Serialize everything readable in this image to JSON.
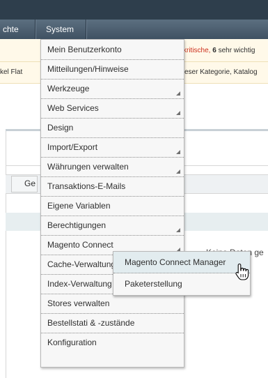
{
  "nav": {
    "partial_label": "chte",
    "system_label": "System"
  },
  "notices": {
    "line1_prefix": "kritische,",
    "line1_count": "6",
    "line1_suffix": "sehr wichtig",
    "line2_left": "kel Flat",
    "line2_right": "eser Kategorie, Katalog"
  },
  "content": {
    "tab_label": "Ge",
    "no_data_text": "Keine Daten ge"
  },
  "system_menu": {
    "items": [
      {
        "label": "Mein Benutzerkonto",
        "has_submenu": false
      },
      {
        "label": "Mitteilungen/Hinweise",
        "has_submenu": false
      },
      {
        "label": "Werkzeuge",
        "has_submenu": true
      },
      {
        "label": "Web Services",
        "has_submenu": true
      },
      {
        "label": "Design",
        "has_submenu": false
      },
      {
        "label": "Import/Export",
        "has_submenu": true
      },
      {
        "label": "Währungen verwalten",
        "has_submenu": true
      },
      {
        "label": "Transaktions-E-Mails",
        "has_submenu": false
      },
      {
        "label": "Eigene Variablen",
        "has_submenu": false
      },
      {
        "label": "Berechtigungen",
        "has_submenu": true
      },
      {
        "label": "Magento Connect",
        "has_submenu": true
      },
      {
        "label": "Cache-Verwaltung",
        "has_submenu": false
      },
      {
        "label": "Index-Verwaltung",
        "has_submenu": false
      },
      {
        "label": "Stores verwalten",
        "has_submenu": false
      },
      {
        "label": "Bestellstati & -zustände",
        "has_submenu": false
      },
      {
        "label": "Konfiguration",
        "has_submenu": false
      }
    ]
  },
  "magento_connect_submenu": {
    "items": [
      {
        "label": "Magento Connect Manager",
        "highlighted": true
      },
      {
        "label": "Paketerstellung",
        "highlighted": false
      }
    ]
  },
  "cursor": {
    "icon": "hand-pointer-icon"
  }
}
